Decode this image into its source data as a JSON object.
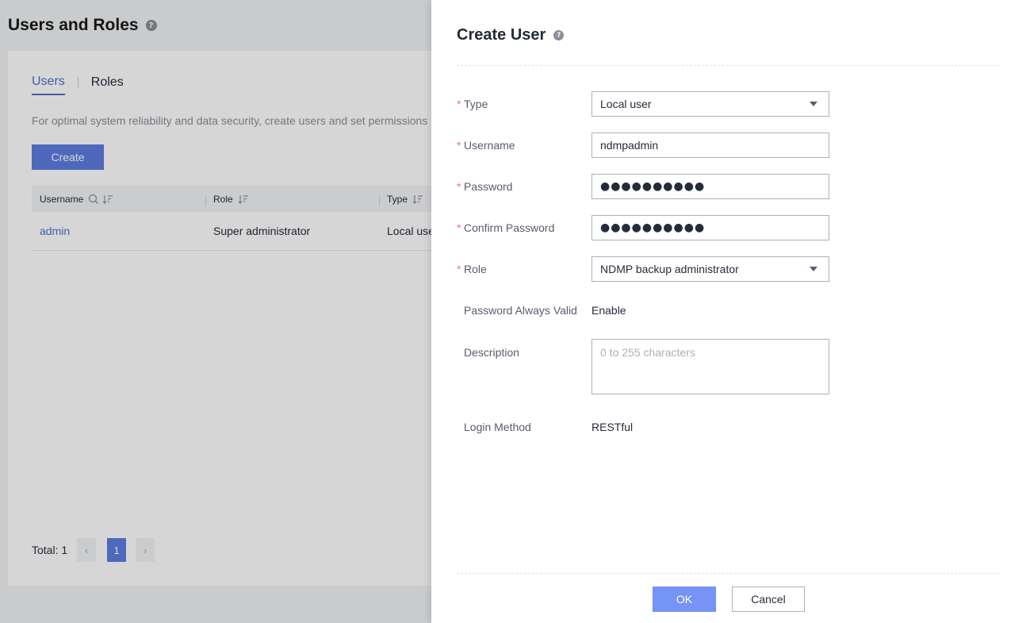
{
  "page": {
    "title": "Users and Roles",
    "help_glyph": "?",
    "tabs": [
      {
        "label": "Users"
      },
      {
        "label": "Roles"
      }
    ],
    "intro": "For optimal system reliability and data security, create users and set permissions",
    "create_label": "Create",
    "table": {
      "columns": [
        {
          "label": "Username"
        },
        {
          "label": "Role"
        },
        {
          "label": "Type"
        }
      ],
      "rows": [
        {
          "username": "admin",
          "role": "Super administrator",
          "type": "Local user"
        }
      ]
    },
    "pager": {
      "total_label": "Total: 1",
      "prev": "‹",
      "page": "1",
      "next": "›"
    }
  },
  "drawer": {
    "title": "Create User",
    "help_glyph": "?",
    "required_mark": "*",
    "fields": {
      "type": {
        "label": "Type",
        "value": "Local user"
      },
      "username": {
        "label": "Username",
        "value": "ndmpadmin"
      },
      "password": {
        "label": "Password",
        "value": "●●●●●●●●●●"
      },
      "confirm_password": {
        "label": "Confirm Password",
        "value": "●●●●●●●●●●"
      },
      "role": {
        "label": "Role",
        "value": "NDMP backup administrator"
      },
      "password_always_valid": {
        "label": "Password Always Valid",
        "value": "Enable"
      },
      "description": {
        "label": "Description",
        "placeholder": "0 to 255 characters"
      },
      "login_method": {
        "label": "Login Method",
        "value": "RESTful"
      }
    },
    "ok_label": "OK",
    "cancel_label": "Cancel"
  },
  "colors": {
    "primary": "#5e7ce0",
    "primary_disabled": "#7693f5",
    "required": "#f66f6a",
    "link": "#526ecc"
  }
}
